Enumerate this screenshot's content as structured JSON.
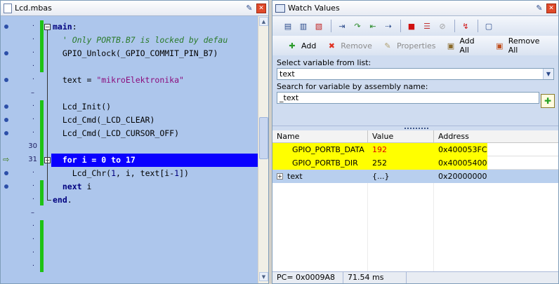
{
  "editor": {
    "tab_title": "Lcd.mbas",
    "lines": [
      {
        "text": "main:",
        "kind": "keyword",
        "bp": true,
        "lnum": "",
        "fold": "open"
      },
      {
        "text": "  ' Only PORTB.B7 is locked by defau",
        "kind": "comment",
        "bp": false,
        "lnum": "",
        "fold": ""
      },
      {
        "text": "  GPIO_Unlock(_GPIO_COMMIT_PIN_B7)",
        "kind": "code",
        "bp": true,
        "lnum": "",
        "fold": ""
      },
      {
        "text": "",
        "kind": "code",
        "bp": false,
        "lnum": "",
        "fold": ""
      },
      {
        "text": "  text = \"mikroElektronika\"",
        "kind": "string",
        "bp": true,
        "lnum": "",
        "fold": ""
      },
      {
        "text": "",
        "kind": "code",
        "bp": false,
        "lnum": "",
        "fold": ""
      },
      {
        "text": "  Lcd_Init()",
        "kind": "code",
        "bp": true,
        "lnum": "",
        "fold": ""
      },
      {
        "text": "  Lcd_Cmd(_LCD_CLEAR)",
        "kind": "code",
        "bp": true,
        "lnum": "",
        "fold": ""
      },
      {
        "text": "  Lcd_Cmd(_LCD_CURSOR_OFF)",
        "kind": "code",
        "bp": true,
        "lnum": "",
        "fold": ""
      },
      {
        "text": "",
        "kind": "code",
        "bp": false,
        "lnum": "30",
        "fold": ""
      },
      {
        "text": "  for i = 0 to 17",
        "kind": "current",
        "bp": false,
        "lnum": "31",
        "fold": "open"
      },
      {
        "text": "    Lcd_Chr(1, i, text[i-1])",
        "kind": "code",
        "bp": true,
        "lnum": "",
        "fold": ""
      },
      {
        "text": "  next i",
        "kind": "keyword",
        "bp": true,
        "lnum": "",
        "fold": ""
      },
      {
        "text": "end.",
        "kind": "keyword",
        "bp": false,
        "lnum": "",
        "fold": ""
      }
    ]
  },
  "watch": {
    "title": "Watch Values",
    "toolbar": {
      "add": "Add",
      "remove": "Remove",
      "properties": "Properties",
      "add_all": "Add All",
      "remove_all": "Remove All"
    },
    "select_label": "Select variable from list:",
    "select_value": "text",
    "search_label": "Search for variable by assembly name:",
    "search_value": "_text",
    "columns": [
      "Name",
      "Value",
      "Address"
    ],
    "rows": [
      {
        "name": "GPIO_PORTB_DATA",
        "value": "192",
        "address": "0x400053FC",
        "changed": true,
        "highlight": true
      },
      {
        "name": "GPIO_PORTB_DIR",
        "value": "252",
        "address": "0x40005400",
        "changed": false,
        "highlight": true
      },
      {
        "name": "text",
        "value": "{...}",
        "address": "0x20000000",
        "changed": false,
        "highlight": false
      }
    ],
    "status": {
      "pc": "PC= 0x0009A8",
      "time": "71.54 ms"
    }
  }
}
